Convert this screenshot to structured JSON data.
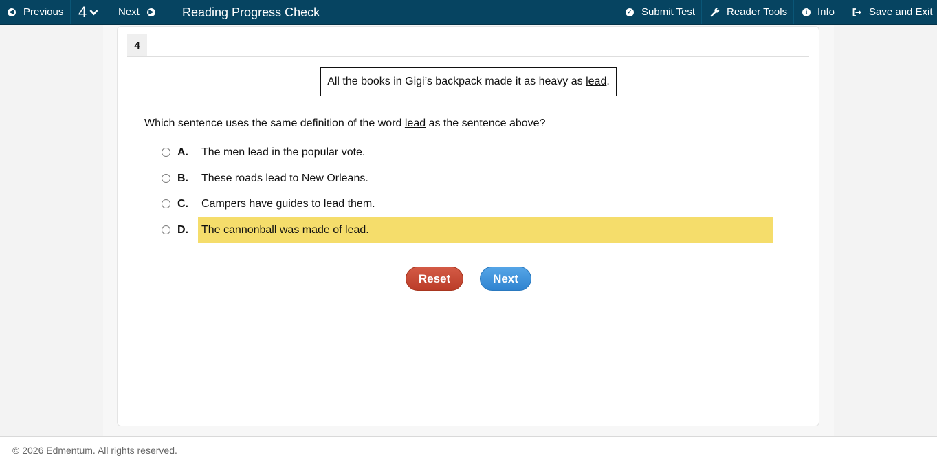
{
  "toolbar": {
    "previous_label": "Previous",
    "question_number": "4",
    "next_label": "Next",
    "title": "Reading Progress Check",
    "submit_label": "Submit Test",
    "reader_tools_label": "Reader Tools",
    "info_label": "Info",
    "save_exit_label": "Save and Exit"
  },
  "question": {
    "tab_number": "4",
    "stimulus_before": "All the books in Gigi’s backpack made it as heavy as ",
    "stimulus_word": "lead",
    "stimulus_after": ".",
    "stem_before": "Which sentence uses the same definition of the word ",
    "stem_word": "lead",
    "stem_after": " as the sentence above?",
    "choices": [
      {
        "letter": "A.",
        "text": "The men lead in the popular vote."
      },
      {
        "letter": "B.",
        "text": "These roads lead to New Orleans."
      },
      {
        "letter": "C.",
        "text": "Campers have guides to lead them."
      },
      {
        "letter": "D.",
        "text": "The cannonball was made of lead.",
        "highlighted": true
      }
    ]
  },
  "buttons": {
    "reset_label": "Reset",
    "next_label": "Next"
  },
  "footer": {
    "copyright": "© 2026 Edmentum. All rights reserved."
  },
  "colors": {
    "toolbar_bg": "#064461",
    "highlight": "#f5dd6b",
    "reset_button": "#c4452f",
    "next_button": "#3f93db"
  },
  "icons": {
    "previous": "arrow-left-circle-icon",
    "question_menu": "chevron-down-icon",
    "next": "arrow-right-circle-icon",
    "submit": "check-circle-icon",
    "reader_tools": "wrench-icon",
    "info": "info-circle-icon",
    "save_exit": "sign-out-icon"
  }
}
